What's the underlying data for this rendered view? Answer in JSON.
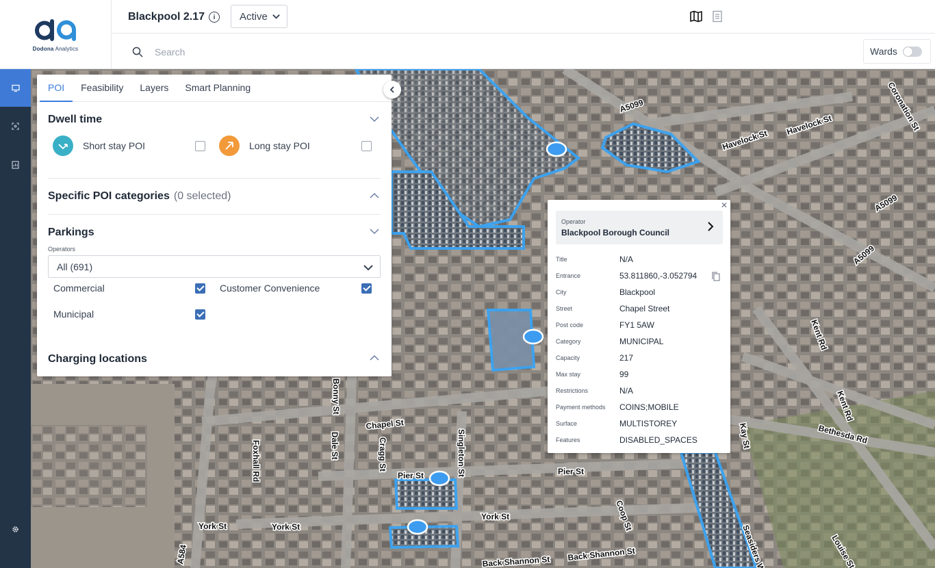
{
  "header": {
    "logo_text_bold": "Dodona",
    "logo_text_light": " Analytics",
    "title": "Blackpool 2.17",
    "status": "Active",
    "search_placeholder": "Search",
    "wards_label": "Wards",
    "wards_on": false
  },
  "panel": {
    "tabs": [
      {
        "label": "POI",
        "active": true
      },
      {
        "label": "Feasibility",
        "active": false
      },
      {
        "label": "Layers",
        "active": false
      },
      {
        "label": "Smart Planning",
        "active": false
      }
    ],
    "dwell": {
      "title": "Dwell time",
      "short_label": "Short stay POI",
      "long_label": "Long stay POI",
      "short_color": "#3ab0c7",
      "long_color": "#f29a3a"
    },
    "specific": {
      "title": "Specific POI categories",
      "count": "(0 selected)"
    },
    "parkings": {
      "title": "Parkings",
      "operators_label": "Operators",
      "operators_value": "All (691)",
      "commercial": "Commercial",
      "customer": "Customer Convenience",
      "municipal": "Municipal"
    },
    "charging": {
      "title": "Charging locations"
    }
  },
  "popup": {
    "operator_label": "Operator",
    "operator_value": "Blackpool Borough Council",
    "rows": [
      {
        "label": "Title",
        "value": "N/A"
      },
      {
        "label": "Entrance",
        "value": "53.811860,-3.052794"
      },
      {
        "label": "City",
        "value": "Blackpool"
      },
      {
        "label": "Street",
        "value": "Chapel Street"
      },
      {
        "label": "Post code",
        "value": "FY1 5AW"
      },
      {
        "label": "Category",
        "value": "MUNICIPAL"
      },
      {
        "label": "Capacity",
        "value": "217"
      },
      {
        "label": "Max stay",
        "value": "99"
      },
      {
        "label": "Restrictions",
        "value": "N/A"
      },
      {
        "label": "Payment methods",
        "value": "COINS;MOBILE"
      },
      {
        "label": "Surface",
        "value": "MULTISTOREY"
      },
      {
        "label": "Features",
        "value": "DISABLED_SPACES"
      }
    ]
  },
  "map": {
    "street_labels": [
      "A5099",
      "Havelock St",
      "Coronation St",
      "A5099",
      "A5099",
      "Chapel St",
      "Pier St",
      "Pier St",
      "York St",
      "York St",
      "York St",
      "Back Shannon St",
      "Back Shannon St",
      "Kent Rd",
      "Kent Rd",
      "Bethesda Rd",
      "Kay St",
      "Foxhall Rd",
      "Dale St",
      "Cragg St",
      "Singleton St",
      "Bonny St",
      "A584",
      "Seasiders Way",
      "Louise St",
      "Coop St",
      "Havelock St"
    ],
    "accent": "#3aa0f0"
  }
}
